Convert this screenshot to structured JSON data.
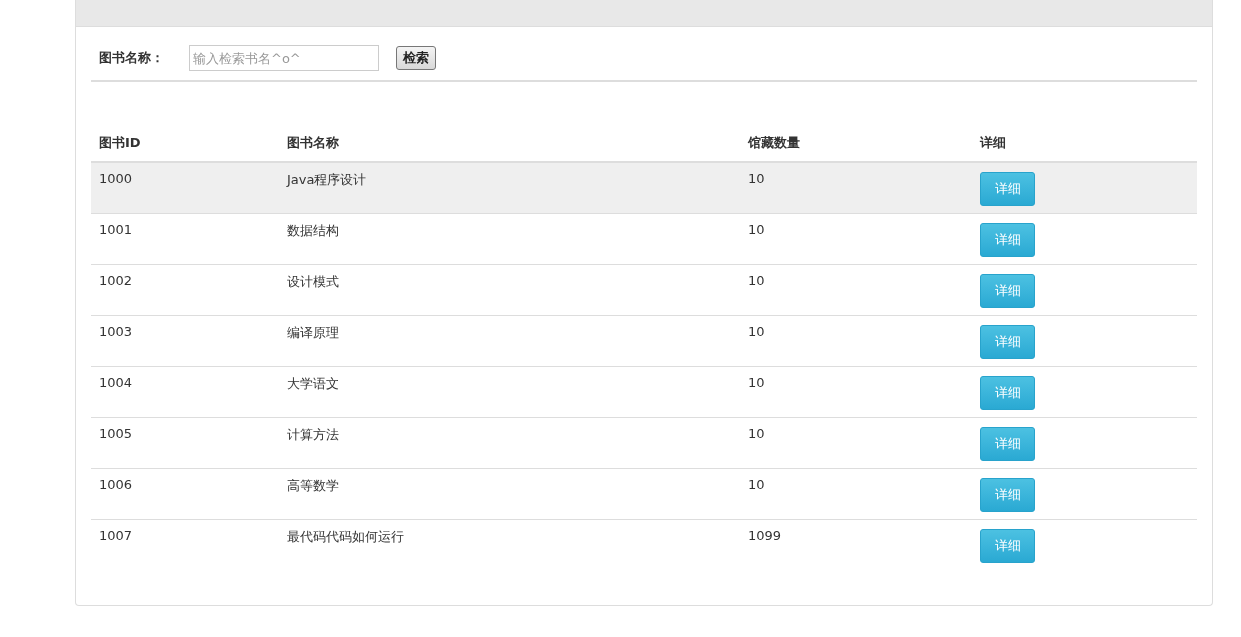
{
  "search": {
    "label": "图书名称：",
    "placeholder": "输入检索书名^o^",
    "button": "检索"
  },
  "table": {
    "columns": [
      "图书ID",
      "图书名称",
      "馆藏数量",
      "详细"
    ],
    "rows": [
      {
        "id": "1000",
        "name": "Java程序设计",
        "count": "10",
        "action": "详细",
        "selected": true
      },
      {
        "id": "1001",
        "name": "数据结构",
        "count": "10",
        "action": "详细",
        "selected": false
      },
      {
        "id": "1002",
        "name": "设计模式",
        "count": "10",
        "action": "详细",
        "selected": false
      },
      {
        "id": "1003",
        "name": "编译原理",
        "count": "10",
        "action": "详细",
        "selected": false
      },
      {
        "id": "1004",
        "name": "大学语文",
        "count": "10",
        "action": "详细",
        "selected": false
      },
      {
        "id": "1005",
        "name": "计算方法",
        "count": "10",
        "action": "详细",
        "selected": false
      },
      {
        "id": "1006",
        "name": "高等数学",
        "count": "10",
        "action": "详细",
        "selected": false
      },
      {
        "id": "1007",
        "name": "最代码代码如何运行",
        "count": "1099",
        "action": "详细",
        "selected": false
      }
    ]
  }
}
